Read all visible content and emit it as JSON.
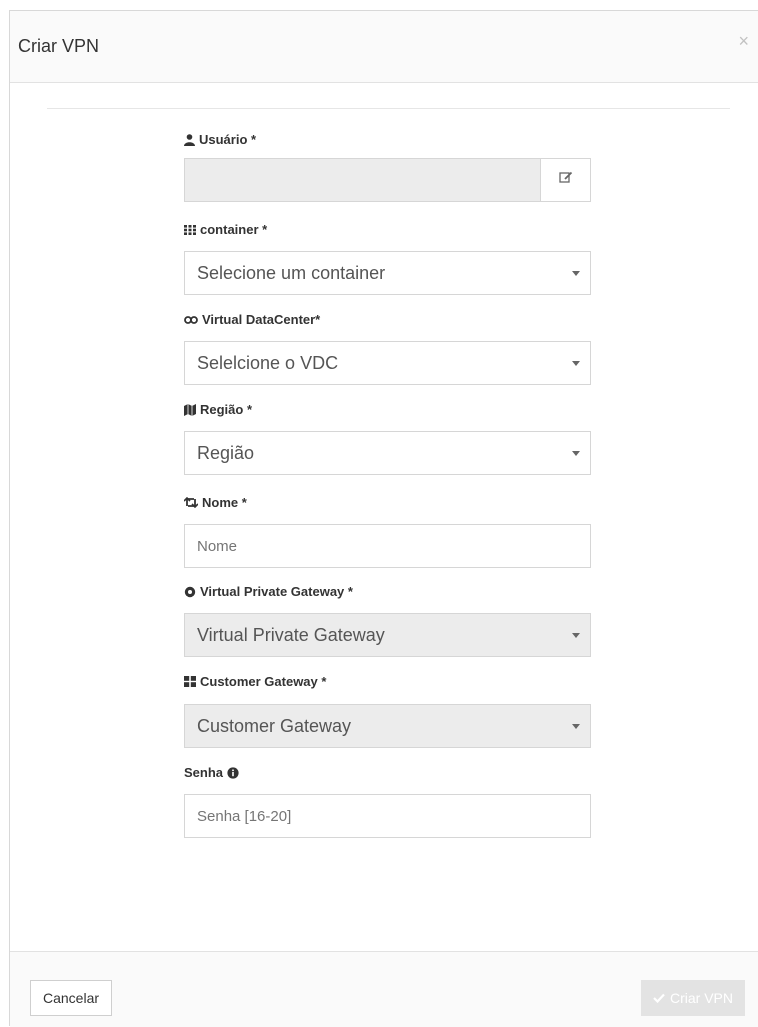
{
  "dialog": {
    "title": "Criar VPN",
    "close": "×"
  },
  "fields": {
    "usuario": {
      "label": "Usuário *",
      "value": ""
    },
    "container": {
      "label": "container *",
      "selected": "Selecione um container"
    },
    "vdc": {
      "label": "Virtual DataCenter*",
      "selected": "Selelcione o VDC"
    },
    "regiao": {
      "label": "Região *",
      "selected": "Região"
    },
    "nome": {
      "label": "Nome *",
      "placeholder": "Nome"
    },
    "vpg": {
      "label": "Virtual Private Gateway *",
      "selected": "Virtual Private Gateway"
    },
    "cgw": {
      "label": "Customer Gateway *",
      "selected": "Customer Gateway"
    },
    "senha": {
      "label": "Senha",
      "placeholder": "Senha [16-20]"
    }
  },
  "footer": {
    "cancel_label": "Cancelar",
    "create_label": "Criar VPN"
  },
  "icons": {
    "usuario": "user-icon",
    "container": "grid-icon",
    "vdc": "link-icon",
    "regiao": "map-icon",
    "nome": "retweet-icon",
    "vpg": "circle-icon",
    "cgw": "th-large-icon",
    "senha": "info-circle-icon",
    "edit": "edit-icon",
    "check": "check-icon"
  },
  "colors": {
    "disabled_bg": "#ececec",
    "border": "#d6d6d6",
    "create_button_disabled": "#e3e3e3"
  }
}
